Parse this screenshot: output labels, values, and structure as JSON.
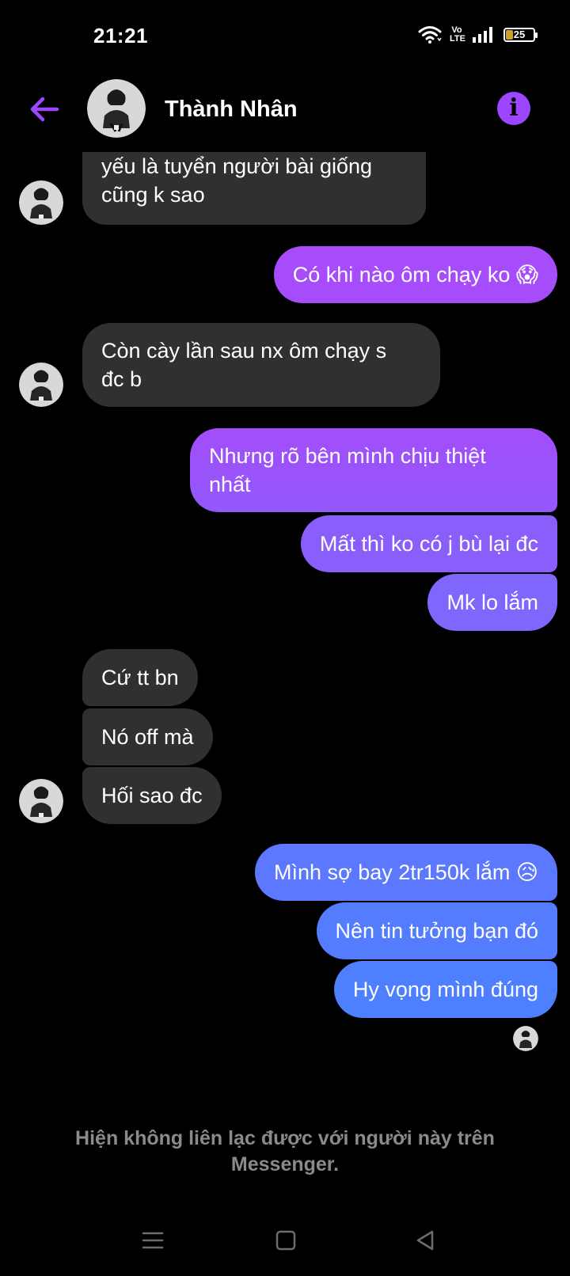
{
  "status_bar": {
    "time": "21:21",
    "network_label": "Vo LTE",
    "battery_level": "25",
    "icons": [
      "wifi-icon",
      "volte-icon",
      "signal-icon",
      "battery-icon"
    ]
  },
  "header": {
    "contact_name": "Thành Nhân",
    "back_icon": "arrow-left-icon",
    "info_icon": "info-icon",
    "info_glyph": "i",
    "accent_color": "#9d46ff"
  },
  "messages": {
    "m1": {
      "lines": [
        "yếu là tuyển người bài giống",
        "cũng k sao"
      ]
    },
    "m2": {
      "text": "Có khi nào ôm chạy ko 😱"
    },
    "m3": {
      "lines": [
        "Còn cày lần sau nx ôm chạy s",
        "đc b"
      ]
    },
    "m4": {
      "lines": [
        "Nhưng rõ bên mình chịu thiệt",
        "nhất"
      ]
    },
    "m5": {
      "text": "Mất thì ko có j bù lại đc"
    },
    "m6": {
      "text": "Mk lo lắm"
    },
    "m7": {
      "text": "Cứ tt bn"
    },
    "m8": {
      "text": "Nó off mà"
    },
    "m9": {
      "text": "Hối sao đc"
    },
    "m10": {
      "text": "Mình sợ bay 2tr150k lắm 😥"
    },
    "m11": {
      "text": "Nên tin tưởng bạn đó"
    },
    "m12": {
      "text": "Hy vọng mình đúng"
    }
  },
  "notice": {
    "line1": "Hiện không liên lạc được với người này trên",
    "line2": "Messenger."
  },
  "nav_bar": {
    "icons": [
      "menu-icon",
      "home-icon",
      "back-triangle-icon"
    ]
  },
  "colors": {
    "incoming_bubble": "#303030",
    "outgoing_gradient_top": "#a64cfa",
    "outgoing_gradient_bottom": "#4d7fff",
    "background": "#000000"
  }
}
